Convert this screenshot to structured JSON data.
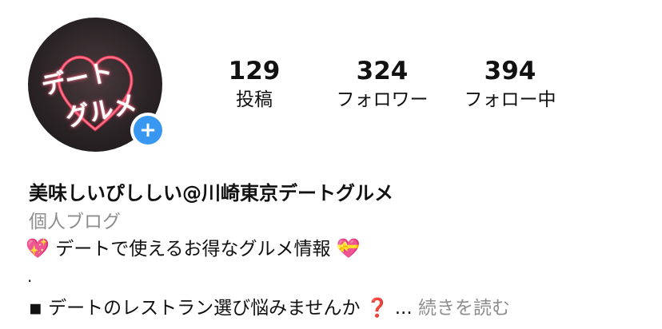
{
  "profile": {
    "avatar_text_line1": "デート",
    "avatar_text_line2": "グルメ",
    "add_icon": "+",
    "stats": {
      "posts": {
        "count": "129",
        "label": "投稿"
      },
      "followers": {
        "count": "324",
        "label": "フォロワー"
      },
      "following": {
        "count": "394",
        "label": "フォロー中"
      }
    },
    "name": "美味しいぴししい@川崎東京デートグルメ",
    "category": "個人ブログ",
    "bio": {
      "line1_emoji_left": "💖",
      "line1_text": "デートで使えるお得なグルメ情報",
      "line1_emoji_right": "💝",
      "dot": ".",
      "line3_bullet": "◾",
      "line3_text": "デートのレストラン選び悩みませんか",
      "line3_emoji": "❓",
      "ellipsis": "...",
      "more_label": "続きを読む"
    }
  },
  "colors": {
    "accent": "#3897f0",
    "secondary_text": "#8e8e8e",
    "primary_text": "#111111",
    "neon": "#ff4d6d"
  }
}
